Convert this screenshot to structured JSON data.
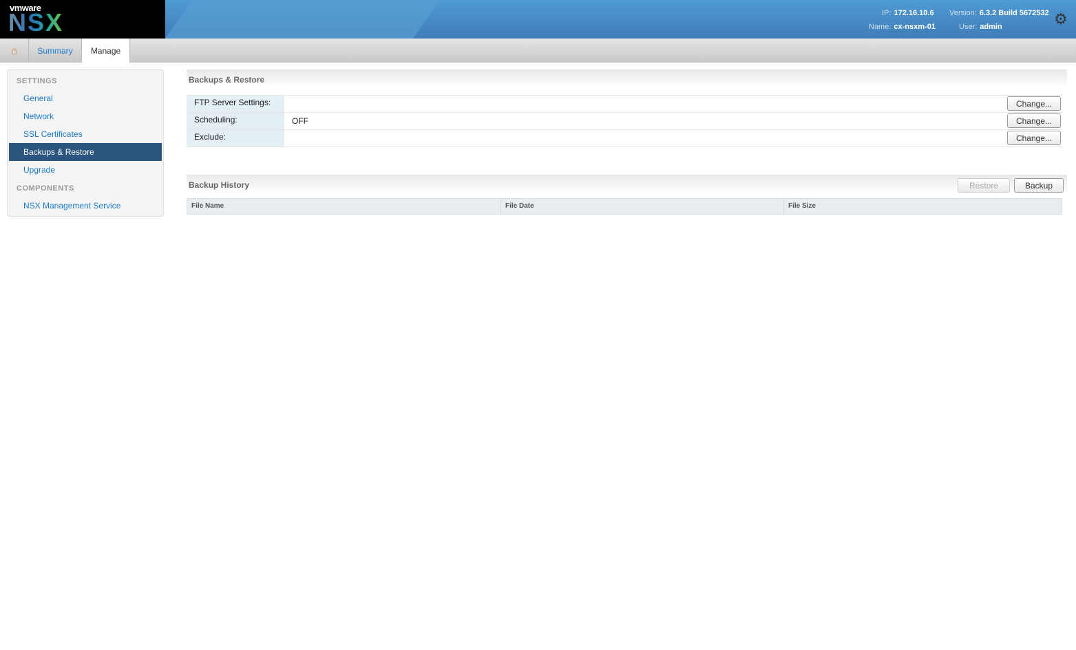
{
  "header": {
    "brand_top": "vmware",
    "brand": "NSX",
    "ip_label": "IP:",
    "ip": "172.16.10.6",
    "version_label": "Version:",
    "version": "6.3.2 Build 5672532",
    "name_label": "Name:",
    "name": "cx-nsxm-01",
    "user_label": "User:",
    "user": "admin"
  },
  "tabs": [
    {
      "label": "Summary"
    },
    {
      "label": "Manage"
    }
  ],
  "sidebar": {
    "settings_heading": "SETTINGS",
    "items": [
      {
        "label": "General"
      },
      {
        "label": "Network"
      },
      {
        "label": "SSL Certificates"
      },
      {
        "label": "Backups & Restore"
      },
      {
        "label": "Upgrade"
      }
    ],
    "components_heading": "COMPONENTS",
    "components": [
      {
        "label": "NSX Management Service"
      }
    ]
  },
  "backups": {
    "title": "Backups & Restore",
    "rows": [
      {
        "label": "FTP Server Settings:",
        "value": "",
        "button": "Change..."
      },
      {
        "label": "Scheduling:",
        "value": "OFF",
        "button": "Change..."
      },
      {
        "label": "Exclude:",
        "value": "",
        "button": "Change..."
      }
    ]
  },
  "history": {
    "title": "Backup History",
    "restore": "Restore",
    "backup": "Backup",
    "columns": [
      "File Name",
      "File Date",
      "File Size"
    ]
  }
}
